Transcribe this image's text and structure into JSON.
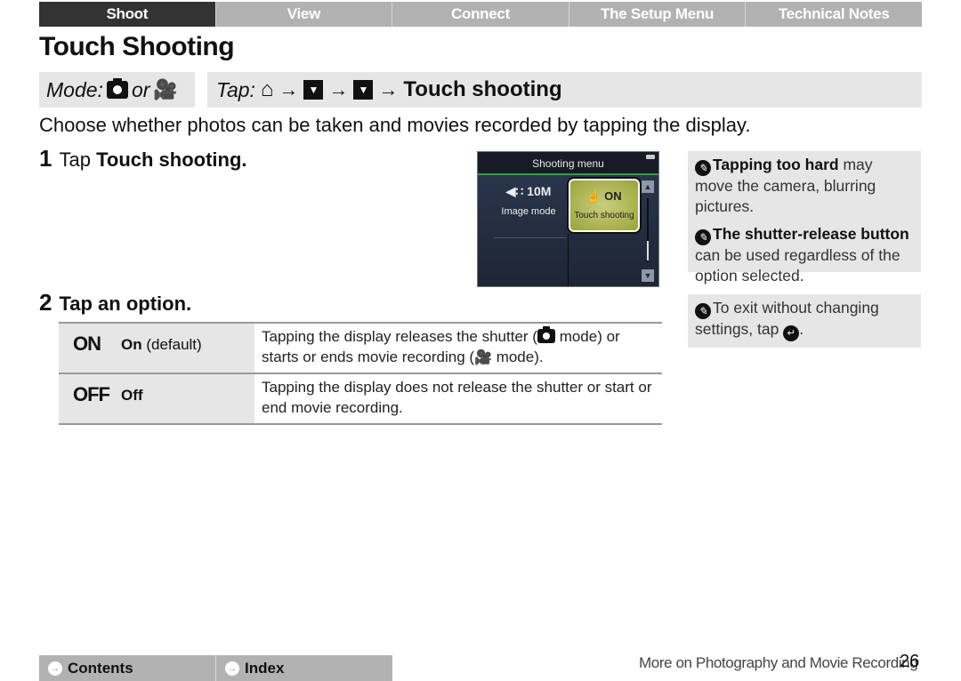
{
  "topnav": {
    "tabs": [
      {
        "label": "Shoot",
        "active": true
      },
      {
        "label": "View",
        "active": false
      },
      {
        "label": "Connect",
        "active": false
      },
      {
        "label": "The Setup Menu",
        "active": false
      },
      {
        "label": "Technical Notes",
        "active": false
      }
    ]
  },
  "page": {
    "title": "Touch Shooting",
    "mode_label": "Mode:",
    "mode_or": "or",
    "tap_label": "Tap:",
    "tap_destination": "Touch shooting",
    "intro": "Choose whether photos can be taken and movies recorded by tapping the display."
  },
  "steps": [
    {
      "number": "1",
      "text_prefix": "Tap",
      "text_bold": "Touch shooting."
    },
    {
      "number": "2",
      "text": "Tap an option."
    }
  ],
  "camera_screen": {
    "header": "Shooting menu",
    "item1_value": "10M",
    "item1_label": "Image mode",
    "item2_value": "ON",
    "item2_label": "Touch shooting"
  },
  "notes": {
    "note1_bold": "Tapping too hard",
    "note1_rest": " may move the camera, blurring pictures.",
    "note2_bold": "The shutter-release button",
    "note2_rest": " can be used regardless of the option selected.",
    "note3_text": "To exit without changing settings, tap",
    "note3_end": "."
  },
  "options": [
    {
      "symbol": "ON",
      "label_bold": "On",
      "label_rest": " (default)",
      "desc_part1": "Tapping the display releases the shutter (",
      "desc_part2": " mode) or starts or ends movie recording (",
      "desc_part3": " mode)."
    },
    {
      "symbol": "OFF",
      "label_bold": "Off",
      "label_rest": "",
      "desc": "Tapping the display does not release the shutter or start or end movie recording."
    }
  ],
  "bottomnav": {
    "contents": "Contents",
    "index": "Index"
  },
  "footer": {
    "section": "More on Photography and Movie Recording",
    "page_number": "26"
  }
}
